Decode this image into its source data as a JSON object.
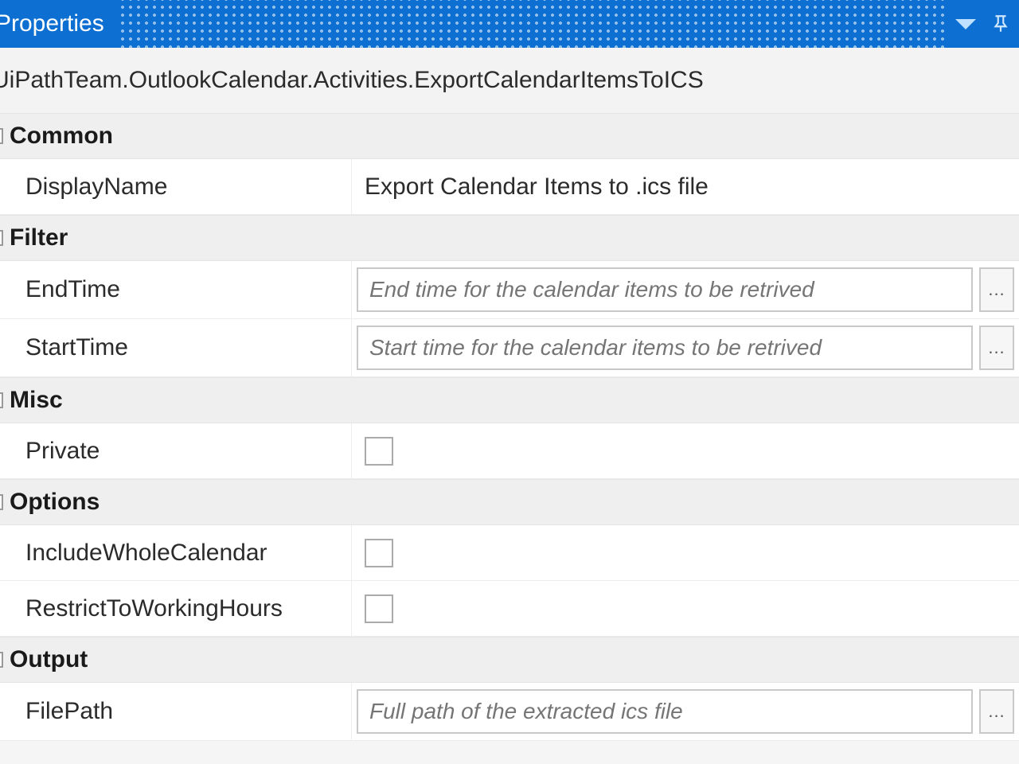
{
  "titlebar": {
    "title": "Properties"
  },
  "classpath": "UiPathTeam.OutlookCalendar.Activities.ExportCalendarItemsToICS",
  "categories": {
    "common": {
      "label": "Common",
      "displayName": {
        "label": "DisplayName",
        "value": "Export Calendar Items to .ics file"
      }
    },
    "filter": {
      "label": "Filter",
      "endTime": {
        "label": "EndTime",
        "placeholder": "End time for the calendar items to be retrived"
      },
      "startTime": {
        "label": "StartTime",
        "placeholder": "Start time for the calendar items to be retrived"
      }
    },
    "misc": {
      "label": "Misc",
      "private": {
        "label": "Private",
        "checked": false
      }
    },
    "options": {
      "label": "Options",
      "includeWholeCalendar": {
        "label": "IncludeWholeCalendar",
        "checked": false
      },
      "restrictToWorkingHours": {
        "label": "RestrictToWorkingHours",
        "checked": false
      }
    },
    "output": {
      "label": "Output",
      "filePath": {
        "label": "FilePath",
        "placeholder": "Full path of the extracted ics file"
      }
    }
  },
  "ui": {
    "browse": "..."
  }
}
